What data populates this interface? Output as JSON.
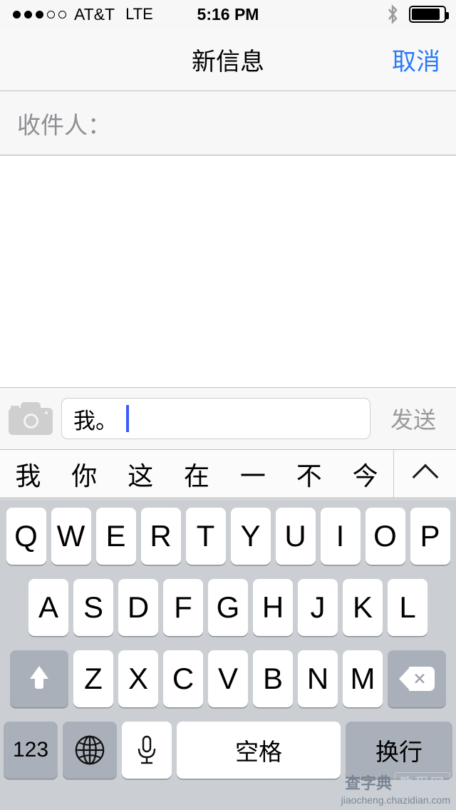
{
  "status_bar": {
    "signal_dots": {
      "total": 5,
      "filled": 3
    },
    "carrier": "AT&T",
    "network": "LTE",
    "time": "5:16 PM",
    "bluetooth_icon": "bluetooth-icon",
    "battery_icon": "battery-icon",
    "battery_level_pct": 88
  },
  "nav_bar": {
    "title": "新信息",
    "cancel_label": "取消"
  },
  "recipient": {
    "label": "收件人：",
    "value": ""
  },
  "input_toolbar": {
    "camera_icon": "camera-icon",
    "message_text": "我。",
    "placeholder": "",
    "send_label": "发送"
  },
  "candidate_bar": {
    "candidates": [
      "我",
      "你",
      "这",
      "在",
      "一",
      "不",
      "今"
    ],
    "expand_icon": "chevron-up-icon"
  },
  "keyboard": {
    "row1": [
      "Q",
      "W",
      "E",
      "R",
      "T",
      "Y",
      "U",
      "I",
      "O",
      "P"
    ],
    "row2": [
      "A",
      "S",
      "D",
      "F",
      "G",
      "H",
      "J",
      "K",
      "L"
    ],
    "row3": [
      "Z",
      "X",
      "C",
      "V",
      "B",
      "N",
      "M"
    ],
    "shift_icon": "shift-arrow-icon",
    "backspace_icon": "backspace-icon",
    "numeric_label": "123",
    "globe_icon": "globe-icon",
    "mic_icon": "microphone-icon",
    "space_label": "空格",
    "return_label": "换行"
  },
  "watermark": {
    "brand": "查字典",
    "section": "教程网",
    "url": "jiaocheng.chazidian.com"
  },
  "colors": {
    "accent_blue": "#2b7bf5",
    "caret_blue": "#3b5afe",
    "keyboard_bg": "#cbcfd4",
    "key_white": "#ffffff",
    "key_dark": "#aab0ba",
    "placeholder_gray": "#8e8e93"
  }
}
